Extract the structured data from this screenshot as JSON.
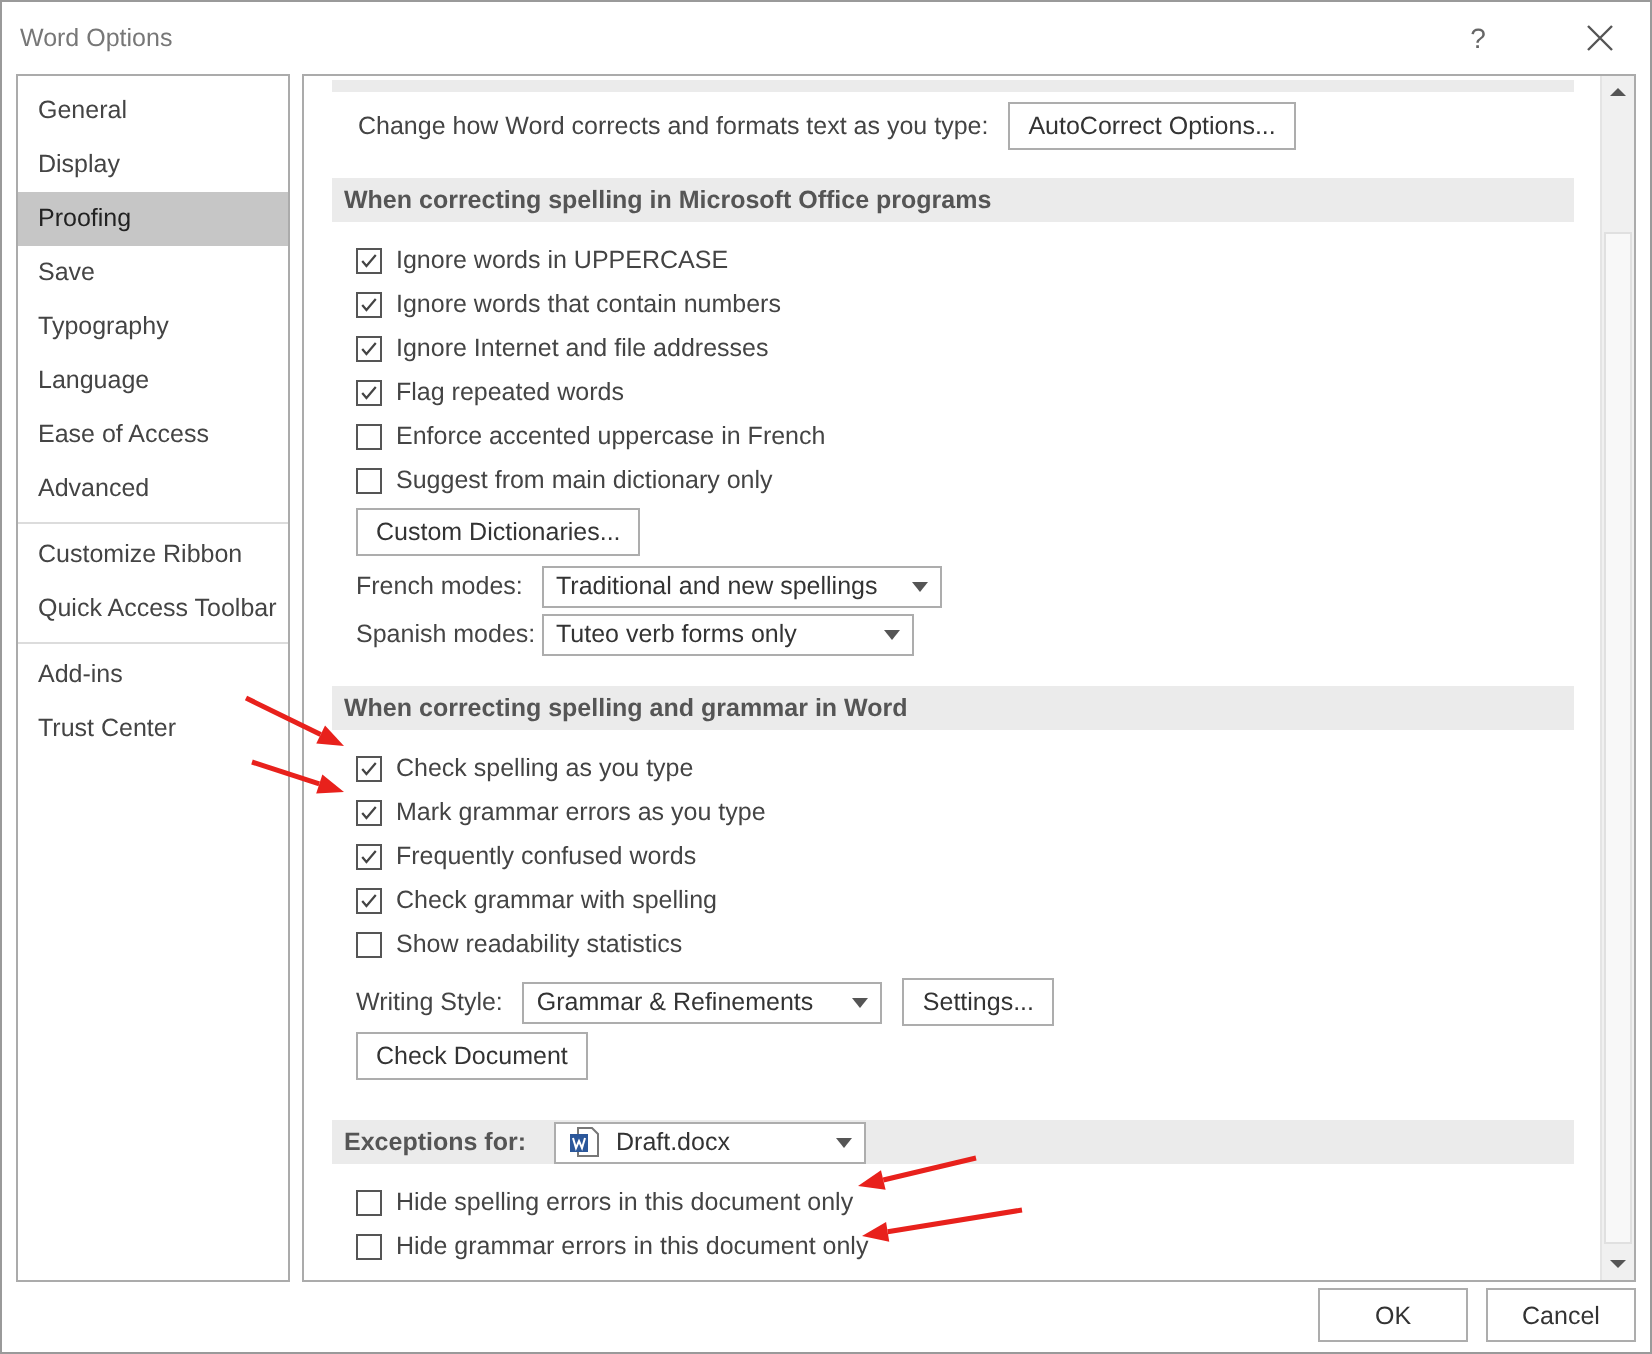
{
  "window": {
    "title": "Word Options",
    "help": "?"
  },
  "sidebar": {
    "groups": [
      {
        "items": [
          {
            "label": "General",
            "selected": false
          },
          {
            "label": "Display",
            "selected": false
          },
          {
            "label": "Proofing",
            "selected": true
          },
          {
            "label": "Save",
            "selected": false
          },
          {
            "label": "Typography",
            "selected": false
          },
          {
            "label": "Language",
            "selected": false
          },
          {
            "label": "Ease of Access",
            "selected": false
          },
          {
            "label": "Advanced",
            "selected": false
          }
        ]
      },
      {
        "items": [
          {
            "label": "Customize Ribbon",
            "selected": false
          },
          {
            "label": "Quick Access Toolbar",
            "selected": false
          }
        ]
      },
      {
        "items": [
          {
            "label": "Add-ins",
            "selected": false
          },
          {
            "label": "Trust Center",
            "selected": false
          }
        ]
      }
    ]
  },
  "autocorrect": {
    "label": "Change how Word corrects and formats text as you type:",
    "button": "AutoCorrect Options..."
  },
  "sections": [
    {
      "title": "When correcting spelling in Microsoft Office programs",
      "rows": [
        {
          "kind": "checkbox",
          "label": "Ignore words in UPPERCASE",
          "checked": true
        },
        {
          "kind": "checkbox",
          "label": "Ignore words that contain numbers",
          "checked": true
        },
        {
          "kind": "checkbox",
          "label": "Ignore Internet and file addresses",
          "checked": true
        },
        {
          "kind": "checkbox",
          "label": "Flag repeated words",
          "checked": true
        },
        {
          "kind": "checkbox",
          "label": "Enforce accented uppercase in French",
          "checked": false
        },
        {
          "kind": "checkbox",
          "label": "Suggest from main dictionary only",
          "checked": false
        },
        {
          "kind": "button",
          "label": "Custom Dictionaries..."
        },
        {
          "kind": "dropdown",
          "label": "French modes:",
          "value": "Traditional and new spellings"
        },
        {
          "kind": "dropdown",
          "label": "Spanish modes:",
          "value": "Tuteo verb forms only"
        }
      ]
    },
    {
      "title": "When correcting spelling and grammar in Word",
      "rows": [
        {
          "kind": "checkbox",
          "label": "Check spelling as you type",
          "checked": true
        },
        {
          "kind": "checkbox",
          "label": "Mark grammar errors as you type",
          "checked": true
        },
        {
          "kind": "checkbox",
          "label": "Frequently confused words",
          "checked": true
        },
        {
          "kind": "checkbox",
          "label": "Check grammar with spelling",
          "checked": true
        },
        {
          "kind": "checkbox",
          "label": "Show readability statistics",
          "checked": false
        },
        {
          "kind": "style",
          "label": "Writing Style:",
          "value": "Grammar & Refinements",
          "button": "Settings..."
        },
        {
          "kind": "button",
          "label": "Check Document"
        }
      ]
    },
    {
      "title": "Exceptions for:",
      "dropdown": {
        "value": "Draft.docx"
      },
      "rows": [
        {
          "kind": "checkbox",
          "label": "Hide spelling errors in this document only",
          "checked": false
        },
        {
          "kind": "checkbox",
          "label": "Hide grammar errors in this document only",
          "checked": false
        }
      ]
    }
  ],
  "buttons": [
    {
      "label": "OK"
    },
    {
      "label": "Cancel"
    }
  ]
}
